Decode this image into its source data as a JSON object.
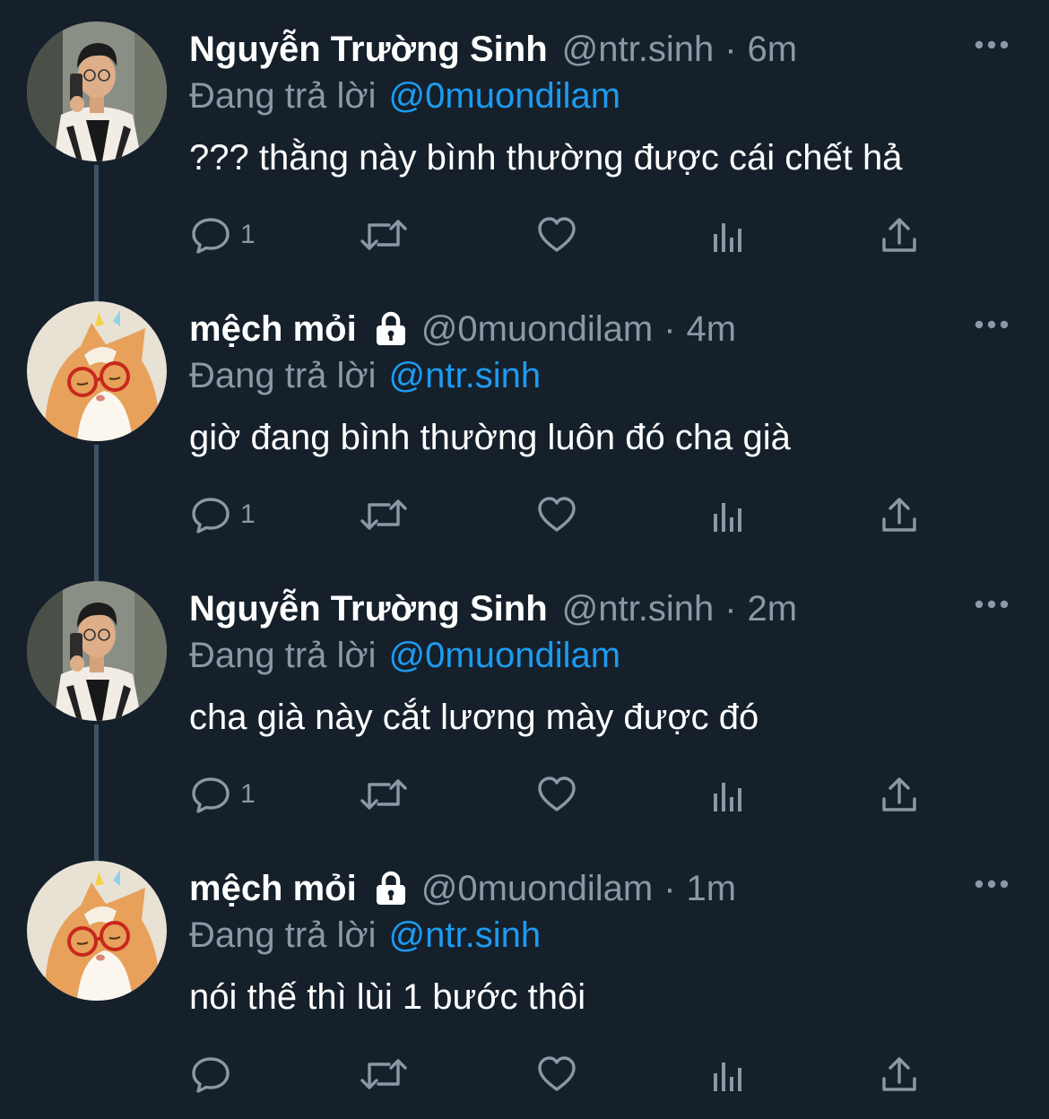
{
  "colors": {
    "background": "#15202b",
    "text_primary": "#ffffff",
    "text_secondary": "#8b98a5",
    "accent": "#1d9bf0",
    "thread_line": "#3d5466"
  },
  "icons": {
    "more": "more-horizontal-icon",
    "reply": "reply-icon",
    "retweet": "retweet-icon",
    "like": "heart-icon",
    "views": "analytics-icon",
    "share": "share-icon",
    "protected": "lock-icon"
  },
  "tweets": [
    {
      "display_name": "Nguyễn Trường Sinh",
      "handle": "@ntr.sinh",
      "separator": "·",
      "time": "6m",
      "protected": false,
      "avatar": "man-mirror-selfie",
      "reply_prefix": "Đang trả lời",
      "reply_mention": "@0muondilam",
      "text": "??? thằng này bình thường được cái chết hả",
      "reply_count": "1"
    },
    {
      "display_name": "mệch mỏi",
      "handle": "@0muondilam",
      "separator": "·",
      "time": "4m",
      "protected": true,
      "avatar": "cat-with-red-glasses",
      "reply_prefix": "Đang trả lời",
      "reply_mention": "@ntr.sinh",
      "text": "giờ đang bình thường luôn đó cha già",
      "reply_count": "1"
    },
    {
      "display_name": "Nguyễn Trường Sinh",
      "handle": "@ntr.sinh",
      "separator": "·",
      "time": "2m",
      "protected": false,
      "avatar": "man-mirror-selfie",
      "reply_prefix": "Đang trả lời",
      "reply_mention": "@0muondilam",
      "text": "cha già này cắt lương mày được đó",
      "reply_count": "1"
    },
    {
      "display_name": "mệch mỏi",
      "handle": "@0muondilam",
      "separator": "·",
      "time": "1m",
      "protected": true,
      "avatar": "cat-with-red-glasses",
      "reply_prefix": "Đang trả lời",
      "reply_mention": "@ntr.sinh",
      "text": "nói thế thì lùi 1 bước thôi",
      "reply_count": ""
    }
  ]
}
